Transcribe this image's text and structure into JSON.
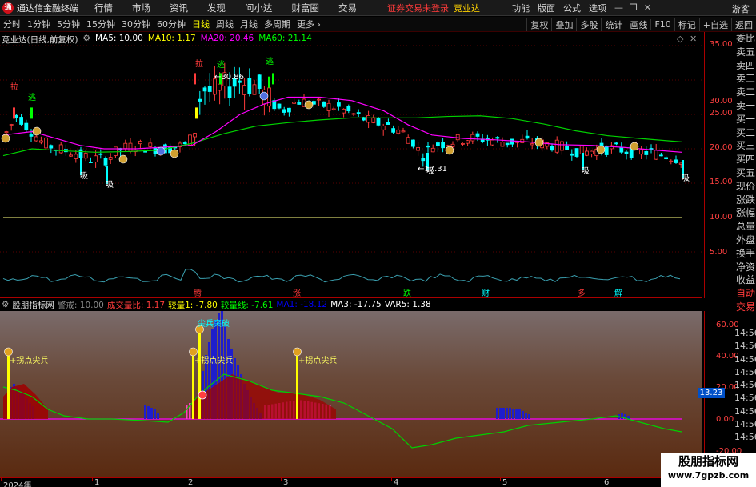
{
  "menubar": {
    "app_title": "通达信金融终端",
    "items": [
      "行情",
      "市场",
      "资讯",
      "发现",
      "问小达",
      "财富圈",
      "交易"
    ],
    "login_status": "证券交易未登录",
    "login_link": "竞业达",
    "right_items": [
      "功能",
      "版面",
      "公式",
      "选项"
    ],
    "guest": "游客"
  },
  "toolbar": {
    "periods": [
      "分时",
      "1分钟",
      "5分钟",
      "15分钟",
      "30分钟",
      "60分钟",
      "日线",
      "周线",
      "月线",
      "多周期",
      "更多"
    ],
    "active_period": "日线",
    "right_buttons": [
      "复权",
      "叠加",
      "多股",
      "统计",
      "画线",
      "F10",
      "标记",
      "+自选",
      "返回"
    ]
  },
  "main_legend": {
    "stock": "竞业达(日线,前复权)",
    "ma5": "MA5: 10.00",
    "ma10": "MA10: 1.17",
    "ma20": "MA20: 20.46",
    "ma60": "MA60: 21.14"
  },
  "price_axis": [
    "35.00",
    "30.00",
    "25.00",
    "20.00",
    "15.00",
    "10.00",
    "5.00"
  ],
  "chart_marks": {
    "high_label": "30.86",
    "low_label": "17.31",
    "la": "拉",
    "tao": "逃",
    "xi": "吸",
    "sub_labels": [
      "腾",
      "涨",
      "跌",
      "财",
      "多",
      "解"
    ]
  },
  "indicator_legend": {
    "name": "股朋指标网",
    "warn": "警戒: 10.00",
    "vol_ratio": "成交量比: 1.17",
    "jl1": "较量1: -7.80",
    "jlx": "较量线: -7.61",
    "ma1": "MA1: -18.12",
    "ma3": "MA3: -17.75",
    "var5": "VAR5: 1.38"
  },
  "indicator_axis": [
    "60.00",
    "40.00",
    "20.00",
    "0.00",
    "-20.00"
  ],
  "indicator_marks": {
    "spike": "拐点尖兵",
    "breakout": "尖兵突破",
    "current": "13.23"
  },
  "info_panel": [
    "委比",
    "卖五",
    "卖四",
    "卖三",
    "卖二",
    "卖一",
    "买一",
    "买二",
    "买三",
    "买四",
    "买五",
    "现价",
    "涨跌",
    "涨幅",
    "总量",
    "外盘",
    "换手",
    "净资",
    "收益",
    "自动",
    "交易"
  ],
  "time_list": [
    "14:56",
    "14:56",
    "14:56",
    "14:56",
    "14:56",
    "14:56",
    "14:56",
    "14:56",
    "14:56",
    "14:56",
    "14:56"
  ],
  "date_axis": [
    "2024年",
    "1",
    "2",
    "3",
    "4",
    "5",
    "6"
  ],
  "watermark": {
    "title": "股朋指标网",
    "url": "www.7gpzb.com"
  },
  "colors": {
    "up": "#ff3b3b",
    "down": "#00ffff",
    "ma5": "#ffffff",
    "ma10": "#ffff00",
    "ma20": "#ff00ff",
    "ma60": "#00ff00"
  }
}
